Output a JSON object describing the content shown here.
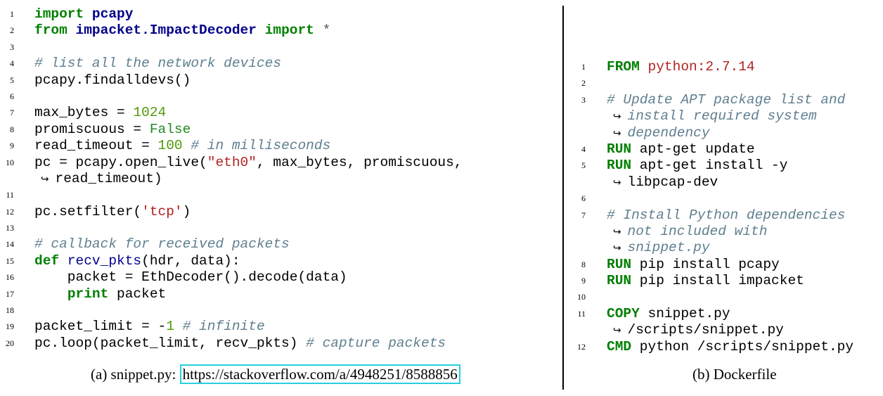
{
  "panel_a": {
    "caption_label": "(a) snippet.py: ",
    "caption_url": "https://stackoverflow.com/a/4948251/8588856",
    "lines": [
      {
        "n": "1",
        "t": "",
        "parts": [
          [
            "kw",
            "import"
          ],
          [
            "",
            ""
          ],
          [
            "nm",
            " pcapy"
          ]
        ]
      },
      {
        "n": "2",
        "parts": [
          [
            "kw",
            "from"
          ],
          [
            "nm",
            " impacket.ImpactDecoder"
          ],
          [
            "kw",
            " import"
          ],
          [
            "star",
            " *"
          ]
        ]
      },
      {
        "n": "3",
        "parts": []
      },
      {
        "n": "4",
        "parts": [
          [
            "cm",
            "# list all the network devices"
          ]
        ]
      },
      {
        "n": "5",
        "parts": [
          [
            "",
            "pcapy.findalldevs()"
          ]
        ]
      },
      {
        "n": "6",
        "parts": []
      },
      {
        "n": "7",
        "parts": [
          [
            "",
            "max_bytes = "
          ],
          [
            "num",
            "1024"
          ]
        ]
      },
      {
        "n": "8",
        "parts": [
          [
            "",
            "promiscuous = "
          ],
          [
            "bool",
            "False"
          ]
        ]
      },
      {
        "n": "9",
        "parts": [
          [
            "",
            "read_timeout = "
          ],
          [
            "num",
            "100"
          ],
          [
            "cm",
            " # in milliseconds"
          ]
        ]
      },
      {
        "n": "10",
        "parts": [
          [
            "",
            "pc = pcapy.open_live("
          ],
          [
            "str",
            "\"eth0\""
          ],
          [
            "",
            ", max_bytes, promiscuous,"
          ]
        ]
      },
      {
        "n": "",
        "parts": [
          [
            "arrow",
            "  ↪  "
          ],
          [
            "",
            "read_timeout)"
          ]
        ]
      },
      {
        "n": "11",
        "parts": []
      },
      {
        "n": "12",
        "parts": [
          [
            "",
            "pc.setfilter("
          ],
          [
            "str",
            "'tcp'"
          ],
          [
            "",
            ")"
          ]
        ]
      },
      {
        "n": "13",
        "parts": []
      },
      {
        "n": "14",
        "parts": [
          [
            "cm",
            "# callback for received packets"
          ]
        ]
      },
      {
        "n": "15",
        "parts": [
          [
            "kw",
            "def"
          ],
          [
            "",
            ""
          ],
          [
            "fn",
            " recv_pkts"
          ],
          [
            "",
            "(hdr, data):"
          ]
        ]
      },
      {
        "n": "16",
        "parts": [
          [
            "",
            "    packet = EthDecoder().decode(data)"
          ]
        ]
      },
      {
        "n": "17",
        "parts": [
          [
            "",
            "    "
          ],
          [
            "kw",
            "print"
          ],
          [
            "",
            " packet"
          ]
        ]
      },
      {
        "n": "18",
        "parts": []
      },
      {
        "n": "19",
        "parts": [
          [
            "",
            "packet_limit = -"
          ],
          [
            "num",
            "1"
          ],
          [
            "cm",
            " # infinite"
          ]
        ]
      },
      {
        "n": "20",
        "parts": [
          [
            "",
            "pc.loop(packet_limit, recv_pkts)"
          ],
          [
            "cm",
            " # capture packets"
          ]
        ]
      }
    ]
  },
  "panel_b": {
    "caption": "(b) Dockerfile",
    "lines": [
      {
        "n": "1",
        "parts": [
          [
            "kw",
            "FROM"
          ],
          [
            "str",
            " python:2.7.14"
          ]
        ]
      },
      {
        "n": "2",
        "parts": []
      },
      {
        "n": "3",
        "parts": [
          [
            "cm",
            "# Update APT package list and"
          ]
        ]
      },
      {
        "n": "",
        "parts": [
          [
            "arrow",
            "  ↪  "
          ],
          [
            "cm",
            "install required system"
          ]
        ]
      },
      {
        "n": "",
        "parts": [
          [
            "arrow",
            "  ↪  "
          ],
          [
            "cm",
            "dependency"
          ]
        ]
      },
      {
        "n": "4",
        "parts": [
          [
            "kw",
            "RUN"
          ],
          [
            "",
            " apt-get update"
          ]
        ]
      },
      {
        "n": "5",
        "parts": [
          [
            "kw",
            "RUN"
          ],
          [
            "",
            " apt-get install -y"
          ]
        ]
      },
      {
        "n": "",
        "parts": [
          [
            "arrow",
            "  ↪  "
          ],
          [
            "",
            "libpcap-dev"
          ]
        ]
      },
      {
        "n": "6",
        "parts": []
      },
      {
        "n": "7",
        "parts": [
          [
            "cm",
            "# Install Python dependencies"
          ]
        ]
      },
      {
        "n": "",
        "parts": [
          [
            "arrow",
            "  ↪  "
          ],
          [
            "cm",
            "not included with"
          ]
        ]
      },
      {
        "n": "",
        "parts": [
          [
            "arrow",
            "  ↪  "
          ],
          [
            "cm",
            "snippet.py"
          ]
        ]
      },
      {
        "n": "8",
        "parts": [
          [
            "kw",
            "RUN"
          ],
          [
            "",
            " pip install pcapy"
          ]
        ]
      },
      {
        "n": "9",
        "parts": [
          [
            "kw",
            "RUN"
          ],
          [
            "",
            " pip install impacket"
          ]
        ]
      },
      {
        "n": "10",
        "parts": []
      },
      {
        "n": "11",
        "parts": [
          [
            "kw",
            "COPY"
          ],
          [
            "",
            " snippet.py"
          ]
        ]
      },
      {
        "n": "",
        "parts": [
          [
            "arrow",
            "  ↪  "
          ],
          [
            "",
            "/scripts/snippet.py"
          ]
        ]
      },
      {
        "n": "12",
        "parts": [
          [
            "kw",
            "CMD"
          ],
          [
            "",
            " python /scripts/snippet.py"
          ]
        ]
      }
    ]
  }
}
